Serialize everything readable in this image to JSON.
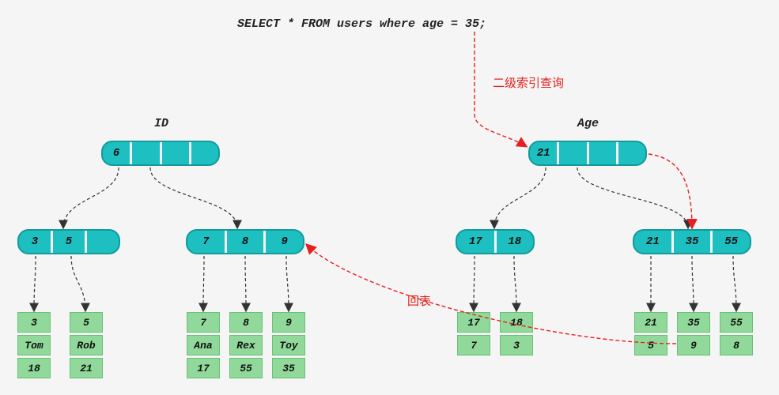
{
  "sql": "SELECT * FROM users where age = 35;",
  "labels": {
    "id": "ID",
    "age": "Age"
  },
  "annotations": {
    "sec_index": "二级索引查询",
    "back_table": "回表"
  },
  "id_tree": {
    "root": [
      "6",
      "",
      "",
      ""
    ],
    "left": [
      "3",
      "5",
      ""
    ],
    "right": [
      "7",
      "8",
      "9"
    ],
    "leaves": [
      {
        "k": "3",
        "v1": "Tom",
        "v2": "18"
      },
      {
        "k": "5",
        "v1": "Rob",
        "v2": "21"
      },
      {
        "k": "7",
        "v1": "Ana",
        "v2": "17"
      },
      {
        "k": "8",
        "v1": "Rex",
        "v2": "55"
      },
      {
        "k": "9",
        "v1": "Toy",
        "v2": "35"
      }
    ]
  },
  "age_tree": {
    "root": [
      "21",
      "",
      "",
      ""
    ],
    "left": [
      "17",
      "18"
    ],
    "right": [
      "21",
      "35",
      "55"
    ],
    "leaves": [
      {
        "k": "17",
        "v1": "7"
      },
      {
        "k": "18",
        "v1": "3"
      },
      {
        "k": "21",
        "v1": "5"
      },
      {
        "k": "35",
        "v1": "9"
      },
      {
        "k": "55",
        "v1": "8"
      }
    ]
  },
  "colors": {
    "node": "#1dbfc1",
    "leaf": "#90d99a",
    "red": "#e62020"
  }
}
